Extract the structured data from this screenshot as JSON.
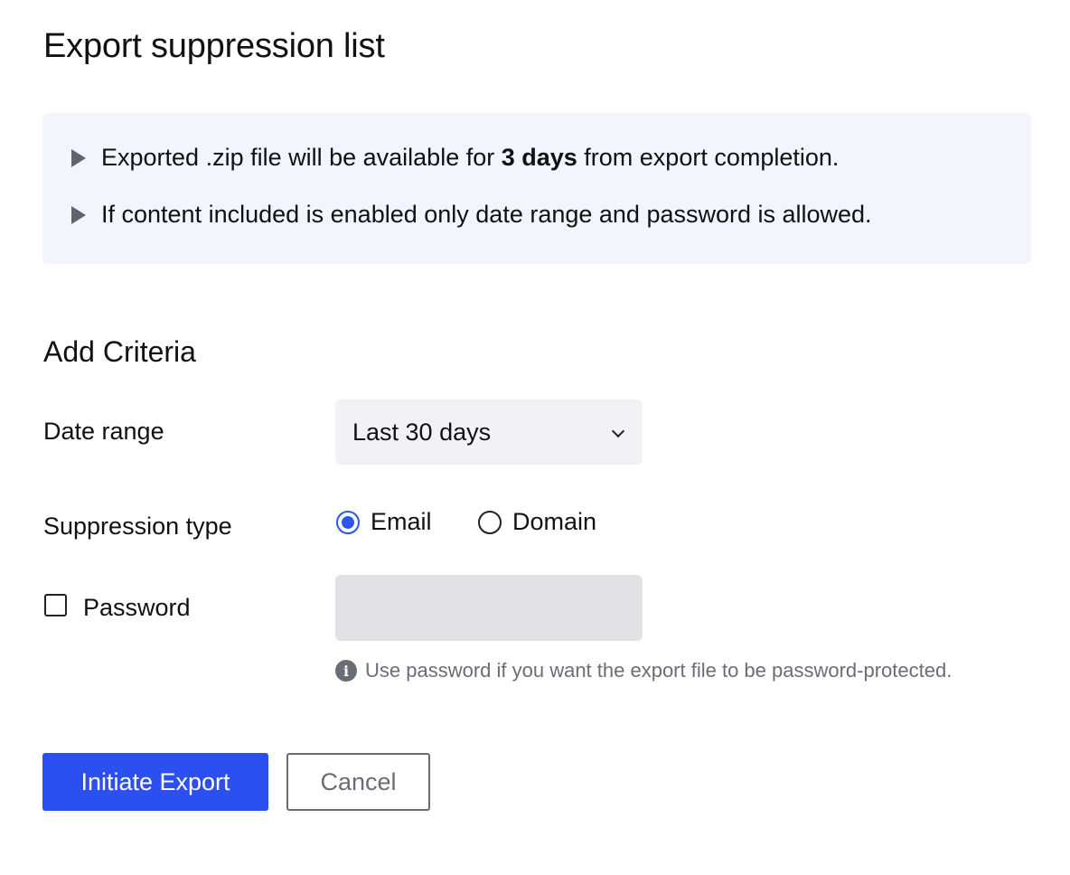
{
  "page_title": "Export suppression list",
  "info": {
    "line1_prefix": "Exported .zip file will be available for ",
    "line1_bold": "3 days",
    "line1_suffix": " from export completion.",
    "line2": "If content included is enabled only date range and password is allowed."
  },
  "criteria": {
    "section_title": "Add Criteria",
    "date_range_label": "Date range",
    "date_range_value": "Last 30 days",
    "suppression_type_label": "Suppression type",
    "suppression_options": [
      "Email",
      "Domain"
    ],
    "suppression_selected": "Email",
    "password_label": "Password",
    "password_checked": false,
    "password_value": "",
    "password_hint": "Use password if you want the export file to be password-protected."
  },
  "actions": {
    "primary_label": "Initiate Export",
    "cancel_label": "Cancel"
  },
  "colors": {
    "accent": "#2b4ff0",
    "info_bg": "#f2f5fd"
  },
  "icons": [
    "triangle-bullet-icon",
    "chevron-down-icon",
    "info-icon"
  ]
}
